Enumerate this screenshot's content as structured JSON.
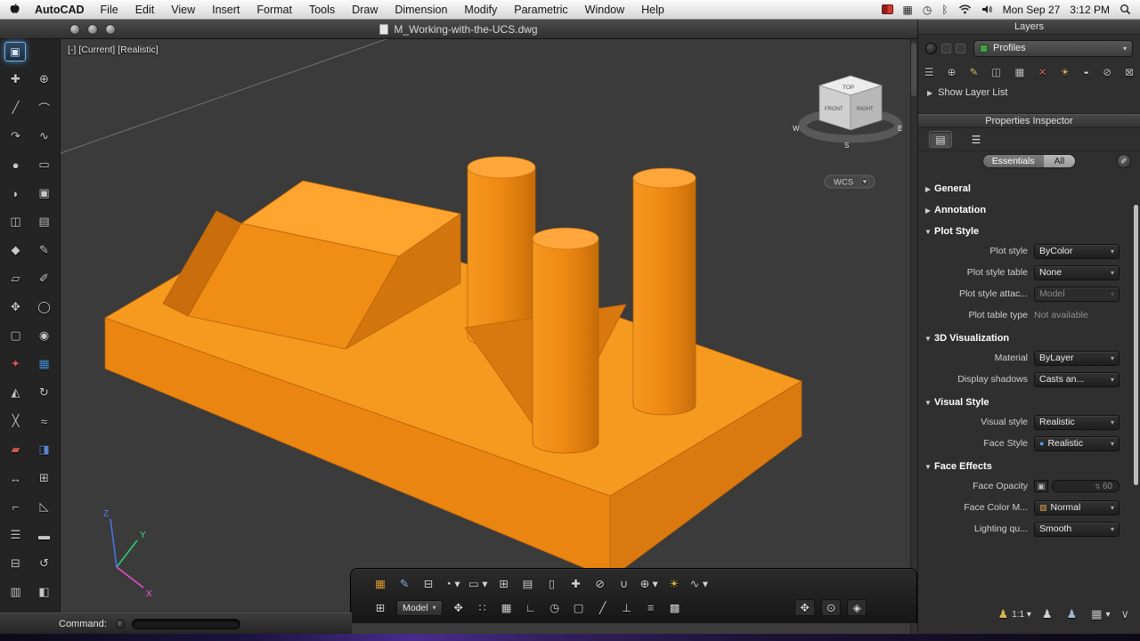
{
  "menu_bar": {
    "app_name": "AutoCAD",
    "menus": [
      "File",
      "Edit",
      "View",
      "Insert",
      "Format",
      "Tools",
      "Draw",
      "Dimension",
      "Modify",
      "Parametric",
      "Window",
      "Help"
    ],
    "status": {
      "date": "Mon Sep 27",
      "time": "3:12 PM"
    }
  },
  "window": {
    "title": "M_Working-with-the-UCS.dwg"
  },
  "viewport": {
    "controls": {
      "menu": "[-]",
      "view": "[Current]",
      "style": "[Realistic]"
    },
    "viewcube": {
      "top": "TOP",
      "front": "FRONT",
      "right": "RIGHT",
      "west": "W",
      "south": "S",
      "east": "E"
    },
    "wcs_label": "WCS",
    "axes": {
      "x": "X",
      "y": "Y",
      "z": "Z"
    }
  },
  "left_toolbar": {
    "active_glyph": "▣",
    "tools": [
      {
        "g": "✚"
      },
      {
        "g": "⊕"
      },
      {
        "g": "╱"
      },
      {
        "g": "⌒"
      },
      {
        "g": "↷"
      },
      {
        "g": "∿"
      },
      {
        "g": "●"
      },
      {
        "g": "▭"
      },
      {
        "g": "◗"
      },
      {
        "g": "▣"
      },
      {
        "g": "◫"
      },
      {
        "g": "▤"
      },
      {
        "g": "◆"
      },
      {
        "g": "✎"
      },
      {
        "g": "▱"
      },
      {
        "g": "✐"
      },
      {
        "g": "✥"
      },
      {
        "g": "◯"
      },
      {
        "g": "▢"
      },
      {
        "g": "◉"
      },
      {
        "g": "✦",
        "s": "color:#d4574e"
      },
      {
        "g": "▦",
        "s": "color:#4e8ed4"
      },
      {
        "g": "◭"
      },
      {
        "g": "↻"
      },
      {
        "g": "╳"
      },
      {
        "g": "≈"
      },
      {
        "g": "▰",
        "s": "color:#c85a50"
      },
      {
        "g": "◨",
        "s": "color:#5a86c8"
      },
      {
        "g": "↔"
      },
      {
        "g": "⊞"
      },
      {
        "g": "⌐"
      },
      {
        "g": "◺"
      },
      {
        "g": "☰"
      },
      {
        "g": "▬"
      },
      {
        "g": "⊟"
      },
      {
        "g": "↺"
      },
      {
        "g": "▥"
      },
      {
        "g": "◧"
      }
    ]
  },
  "layers": {
    "title": "Layers",
    "profiles_label": "Profiles",
    "show_layer_list": "Show Layer List",
    "tools": [
      {
        "g": "☰"
      },
      {
        "g": "⊕"
      },
      {
        "g": "✎",
        "s": "color:#d6ca6f"
      },
      {
        "g": "◫"
      },
      {
        "g": "▦"
      },
      {
        "g": "✕",
        "s": "color:#c96a5a"
      },
      {
        "g": "☀",
        "s": "color:#ddc05c"
      },
      {
        "g": "◒"
      },
      {
        "g": "⊘"
      },
      {
        "g": "⊠"
      }
    ]
  },
  "properties": {
    "title": "Properties Inspector",
    "tabs": [
      {
        "g": "▤"
      },
      {
        "g": "☰"
      }
    ],
    "filters": {
      "essentials": "Essentials",
      "all": "All",
      "tool_glyph": "✐"
    },
    "items": [
      {
        "t": "h",
        "tri": "▶",
        "label": "General"
      },
      {
        "t": "h",
        "tri": "▶",
        "label": "Annotation"
      },
      {
        "t": "h",
        "tri": "▼",
        "label": "Plot Style"
      },
      {
        "t": "r",
        "label": "Plot style",
        "vk": "dd",
        "value": "ByColor"
      },
      {
        "t": "r",
        "label": "Plot style table",
        "vk": "dd",
        "value": "None"
      },
      {
        "t": "r",
        "label": "Plot style attac...",
        "vk": "disabled",
        "value": "Model"
      },
      {
        "t": "r",
        "label": "Plot table type",
        "vk": "plain",
        "value": "Not available"
      },
      {
        "t": "h",
        "tri": "▼",
        "label": "3D Visualization"
      },
      {
        "t": "r",
        "label": "Material",
        "vk": "dd",
        "value": "ByLayer"
      },
      {
        "t": "r",
        "label": "Display shadows",
        "vk": "dd",
        "value": "Casts an..."
      },
      {
        "t": "h",
        "tri": "▼",
        "label": "Visual Style"
      },
      {
        "t": "r",
        "label": "Visual style",
        "vk": "dd",
        "value": "Realistic"
      },
      {
        "t": "r",
        "label": "Face Style",
        "vk": "dd",
        "value": "Realistic",
        "icon": "●",
        "istyle": "color:#4fa0f0"
      },
      {
        "t": "h",
        "tri": "▼",
        "label": "Face Effects"
      },
      {
        "t": "r",
        "label": "Face Opacity",
        "vk": "opacity",
        "value": "60",
        "icon": "▣"
      },
      {
        "t": "r",
        "label": "Face Color M...",
        "vk": "dd",
        "value": "Normal",
        "icon": "▨",
        "istyle": "color:#d8a24e"
      },
      {
        "t": "r",
        "label": "Lighting qu...",
        "vk": "dd",
        "value": "Smooth"
      }
    ]
  },
  "bottom_toolbar": {
    "row1": [
      {
        "g": "▦",
        "s": "color:#dfa23c"
      },
      {
        "g": "✎",
        "s": "color:#8fb9e8"
      },
      {
        "g": "⊟"
      },
      {
        "g": "◔ ▾"
      },
      {
        "g": "▭ ▾"
      },
      {
        "g": "⊞"
      },
      {
        "g": "▤"
      },
      {
        "g": "▯"
      },
      {
        "g": "✚"
      },
      {
        "g": "⊘"
      },
      {
        "g": "∪"
      },
      {
        "g": "⊕ ▾"
      },
      {
        "g": "☀",
        "s": "color:#e3c44c"
      },
      {
        "g": "∿ ▾"
      }
    ],
    "row2_pre": [
      {
        "g": "⊞"
      }
    ],
    "model_label": "Model",
    "row2_main": [
      {
        "g": "✥"
      },
      {
        "g": "∷"
      },
      {
        "g": "▦"
      },
      {
        "g": "∟"
      },
      {
        "g": "◷"
      },
      {
        "g": "▢"
      },
      {
        "g": "╱"
      },
      {
        "g": "⊥"
      },
      {
        "g": "≡"
      },
      {
        "g": "▩"
      }
    ],
    "row2_nav": [
      {
        "g": "✥",
        "n": "pan-tool"
      },
      {
        "g": "⊙",
        "n": "zoom-tool"
      },
      {
        "g": "◈",
        "n": "orbit-tool"
      }
    ]
  },
  "panel_status": {
    "items": [
      {
        "g": "♟",
        "t": "1:1 ▾",
        "s": "color:#d9b648"
      },
      {
        "g": "♟",
        "t": "",
        "s": "color:#d0d0d0"
      },
      {
        "g": "♟",
        "t": "",
        "s": "color:#9fb7d4"
      },
      {
        "g": "▦",
        "t": "▾",
        "s": "color:#c9c9c9"
      },
      {
        "g": "∨",
        "t": "",
        "s": "color:#bdbdbd"
      }
    ]
  },
  "command_bar": {
    "label": "Command:"
  },
  "colors": {
    "model_orange": "#f59a1f",
    "profiles_swatch": "#43a047",
    "highlight_blue": "#69b4f0"
  }
}
